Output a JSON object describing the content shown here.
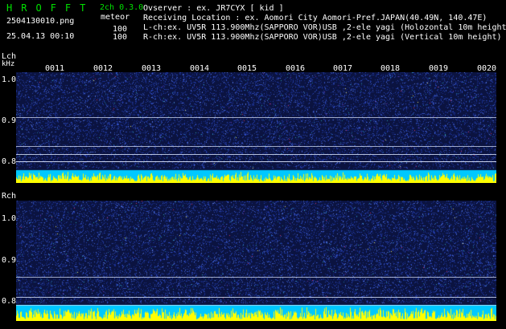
{
  "header": {
    "brand": "HROFFT",
    "mode": "2ch 0.3.0",
    "meteor_label": "meteor",
    "filename": "2504130010.png",
    "datetime": "25.04.13 00:10",
    "count_top": "100",
    "count_bottom": "100",
    "observer": "Ovserver              : ex. JR7CYX [ kid ]",
    "location": "Receiving Location : ex. Aomori City Aomori-Pref.JAPAN(40.49N, 140.47E)",
    "lch_info": "L-ch:ex. UV5R 113.900Mhz(SAPPORO VOR)USB ,2-ele yagi (Holozontal 10m height",
    "rch_info": "R-ch:ex. UV5R 113.900Mhz(SAPPORO VOR)USB ,2-ele yagi (Vertical 10m height)"
  },
  "lch": {
    "label": "Lch",
    "unit": "kHz",
    "time_ticks": [
      "0011",
      "0012",
      "0013",
      "0014",
      "0015",
      "0016",
      "0017",
      "0018",
      "0019",
      "0020"
    ],
    "freq_ticks": [
      "1.0",
      "0.9",
      "0.8"
    ]
  },
  "rch": {
    "label": "Rch",
    "freq_ticks": [
      "1.0",
      "0.9",
      "0.8"
    ]
  },
  "colors": {
    "background": "#000000",
    "spectrogram": "#0b1340",
    "amplitude": "#ffff00",
    "baseline": "#00c8ff",
    "header_text": "#ffffff",
    "brand_text": "#00e000"
  }
}
